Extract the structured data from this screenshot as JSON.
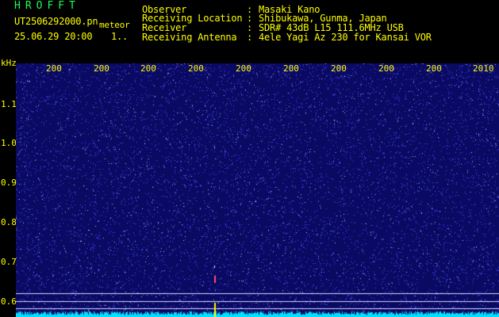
{
  "header": {
    "app_title": "HROFFT",
    "filename": "UT2506292000.pn",
    "date_time": "25.06.29 20:00",
    "page_indicator": "1..",
    "mode": "meteor",
    "info": [
      {
        "label": "Observer",
        "value": "Masaki Kano"
      },
      {
        "label": "Receiving Location",
        "value": "Shibukawa, Gunma, Japan"
      },
      {
        "label": "Receiver",
        "value": "SDR# 43dB L15 111.6MHz USB"
      },
      {
        "label": "Receiving Antenna",
        "value": "4ele Yagi Az 230 for Kansai VOR"
      }
    ]
  },
  "spectrogram": {
    "y_unit": "kHz",
    "y_ticks": [
      "1.1",
      "1.0",
      "0.9",
      "0.8",
      "0.7",
      "0.6"
    ],
    "x_ticks": [
      "200",
      "200",
      "200",
      "200",
      "200",
      "200",
      "200",
      "200",
      "200",
      "2010"
    ],
    "colors": {
      "background": "#0a0a62",
      "noise_dot": "#3c3cff",
      "bright_dot": "#b4b4ff",
      "baseline": "#00e0ff",
      "meteor_trace": "#ff5070",
      "meteor_core": "#ffff00",
      "grid_line": "#d8d8ff"
    }
  }
}
